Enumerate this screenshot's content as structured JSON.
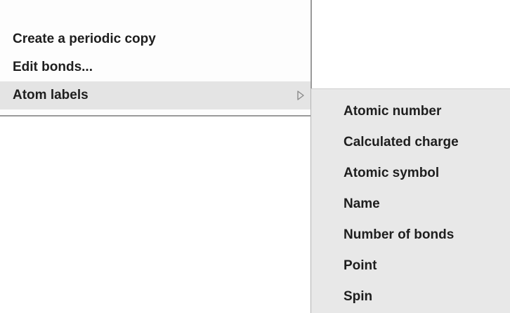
{
  "context_menu": {
    "items": [
      {
        "label": "Create a periodic copy"
      },
      {
        "label": "Edit bonds..."
      },
      {
        "label": "Atom labels",
        "has_submenu": true,
        "active": true
      }
    ],
    "submenu_arrow_icon": "triangle-right-icon"
  },
  "atom_labels_submenu": {
    "items": [
      {
        "label": "Atomic number"
      },
      {
        "label": "Calculated charge"
      },
      {
        "label": "Atomic symbol"
      },
      {
        "label": "Name"
      },
      {
        "label": "Number of bonds"
      },
      {
        "label": "Point"
      },
      {
        "label": "Spin"
      }
    ]
  },
  "colors": {
    "menu_background": "#fdfdfd",
    "active_item_background": "#e4e4e4",
    "submenu_background": "#e8e8e8",
    "text": "#1e1e1e"
  }
}
